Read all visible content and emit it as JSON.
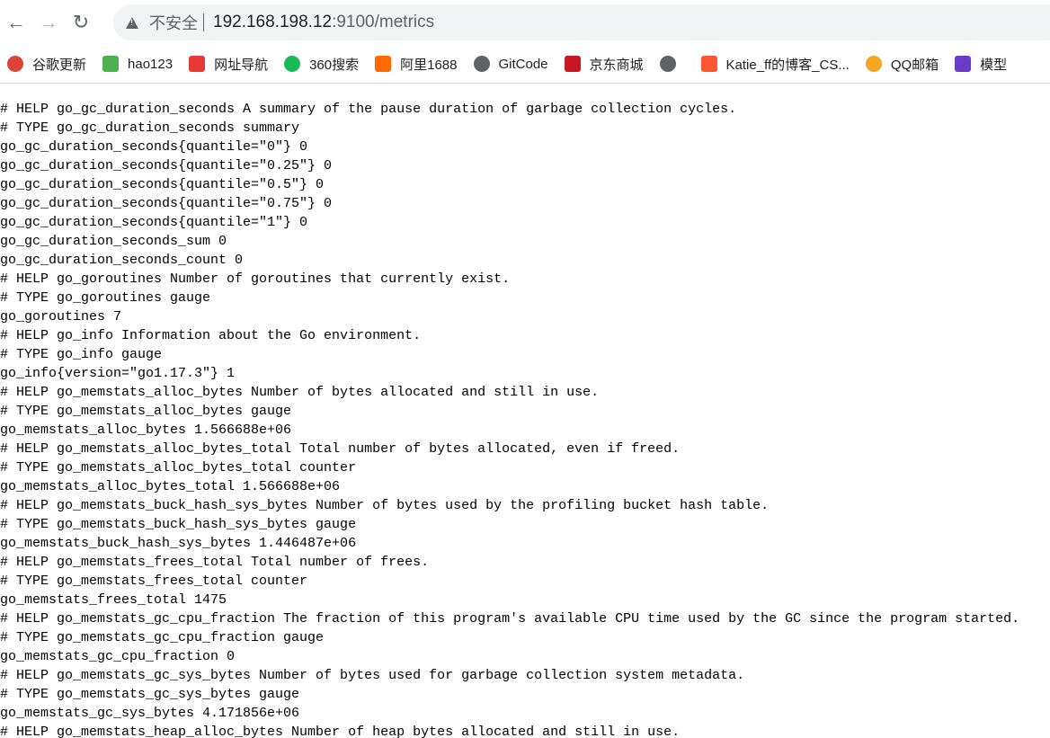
{
  "browser": {
    "security_label": "不安全",
    "url_host": "192.168.198.12",
    "url_rest": ":9100/metrics",
    "nav": [
      "back-icon",
      "forward-icon",
      "reload-icon"
    ]
  },
  "bookmarks": [
    {
      "label": "谷歌更新",
      "icon": "chrome-icon",
      "color": "#db4437"
    },
    {
      "label": "hao123",
      "icon": "hao123-icon",
      "color": "#4caf50"
    },
    {
      "label": "网址导航",
      "icon": "2345-icon",
      "color": "#e53935"
    },
    {
      "label": "360搜索",
      "icon": "360-icon",
      "color": "#19b955"
    },
    {
      "label": "阿里1688",
      "icon": "alibaba-icon",
      "color": "#ff6a00"
    },
    {
      "label": "GitCode",
      "icon": "globe-icon",
      "color": "#5f6368"
    },
    {
      "label": "京东商城",
      "icon": "jd-icon",
      "color": "#c91623"
    },
    {
      "label": "",
      "icon": "globe-icon",
      "color": "#5f6368"
    },
    {
      "label": "Katie_ff的博客_CS...",
      "icon": "csdn-icon",
      "color": "#fc5531"
    },
    {
      "label": "QQ邮箱",
      "icon": "qqmail-icon",
      "color": "#f5a623"
    },
    {
      "label": "模型",
      "icon": "zl-icon",
      "color": "#6a3cc9"
    }
  ],
  "lines": [
    "# HELP go_gc_duration_seconds A summary of the pause duration of garbage collection cycles.",
    "# TYPE go_gc_duration_seconds summary",
    "go_gc_duration_seconds{quantile=\"0\"} 0",
    "go_gc_duration_seconds{quantile=\"0.25\"} 0",
    "go_gc_duration_seconds{quantile=\"0.5\"} 0",
    "go_gc_duration_seconds{quantile=\"0.75\"} 0",
    "go_gc_duration_seconds{quantile=\"1\"} 0",
    "go_gc_duration_seconds_sum 0",
    "go_gc_duration_seconds_count 0",
    "# HELP go_goroutines Number of goroutines that currently exist.",
    "# TYPE go_goroutines gauge",
    "go_goroutines 7",
    "# HELP go_info Information about the Go environment.",
    "# TYPE go_info gauge",
    "go_info{version=\"go1.17.3\"} 1",
    "# HELP go_memstats_alloc_bytes Number of bytes allocated and still in use.",
    "# TYPE go_memstats_alloc_bytes gauge",
    "go_memstats_alloc_bytes 1.566688e+06",
    "# HELP go_memstats_alloc_bytes_total Total number of bytes allocated, even if freed.",
    "# TYPE go_memstats_alloc_bytes_total counter",
    "go_memstats_alloc_bytes_total 1.566688e+06",
    "# HELP go_memstats_buck_hash_sys_bytes Number of bytes used by the profiling bucket hash table.",
    "# TYPE go_memstats_buck_hash_sys_bytes gauge",
    "go_memstats_buck_hash_sys_bytes 1.446487e+06",
    "# HELP go_memstats_frees_total Total number of frees.",
    "# TYPE go_memstats_frees_total counter",
    "go_memstats_frees_total 1475",
    "# HELP go_memstats_gc_cpu_fraction The fraction of this program's available CPU time used by the GC since the program started.",
    "# TYPE go_memstats_gc_cpu_fraction gauge",
    "go_memstats_gc_cpu_fraction 0",
    "# HELP go_memstats_gc_sys_bytes Number of bytes used for garbage collection system metadata.",
    "# TYPE go_memstats_gc_sys_bytes gauge",
    "go_memstats_gc_sys_bytes 4.171856e+06",
    "# HELP go_memstats_heap_alloc_bytes Number of heap bytes allocated and still in use."
  ]
}
